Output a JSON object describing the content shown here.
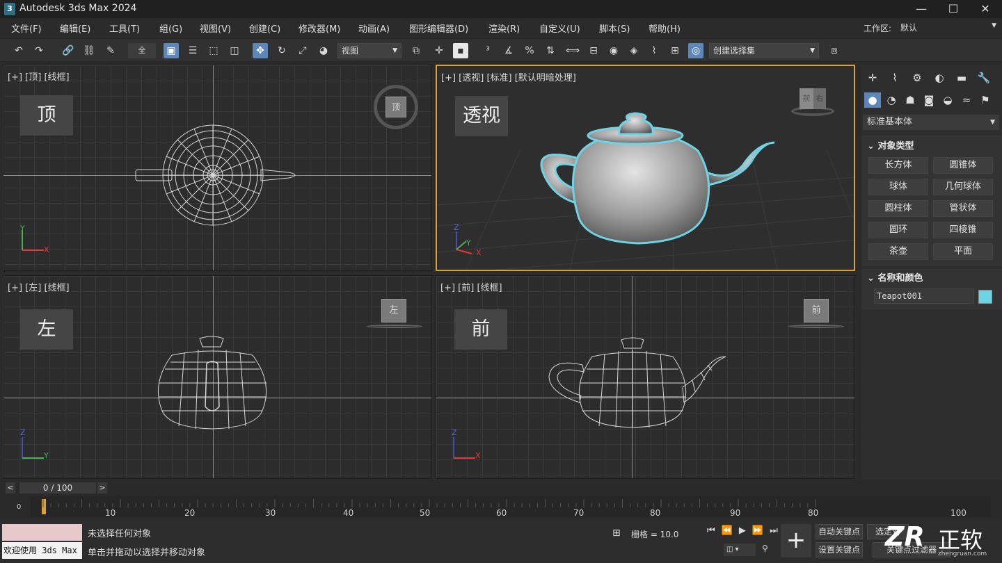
{
  "app": {
    "title": "Autodesk 3ds Max 2024",
    "icon_label": "3"
  },
  "window_controls": {
    "minimize": "—",
    "maximize": "☐",
    "close": "✕"
  },
  "menu": [
    "文件(F)",
    "编辑(E)",
    "工具(T)",
    "组(G)",
    "视图(V)",
    "创建(C)",
    "修改器(M)",
    "动画(A)",
    "图形编辑器(D)",
    "渲染(R)",
    "自定义(U)",
    "脚本(S)",
    "帮助(H)"
  ],
  "workspace": {
    "label": "工作区:",
    "value": "默认"
  },
  "toolbar": {
    "view_combo": "视图",
    "selection_set": "创建选择集"
  },
  "viewports": {
    "top": {
      "label": "[+] [顶] [线框]",
      "tag": "顶",
      "cube_label": "顶",
      "axis_x": "X",
      "axis_y": "Y"
    },
    "persp": {
      "label": "[+] [透视] [标准] [默认明暗处理]",
      "tag": "透视",
      "cube_face1": "前",
      "cube_face2": "右",
      "axis_x": "X",
      "axis_y": "Y",
      "axis_z": "Z"
    },
    "left": {
      "label": "[+] [左] [线框]",
      "tag": "左",
      "cube_label": "左",
      "axis_y": "Y",
      "axis_z": "Z"
    },
    "front": {
      "label": "[+] [前] [线框]",
      "tag": "前",
      "cube_label": "前",
      "axis_x": "X",
      "axis_z": "Z"
    }
  },
  "command_panel": {
    "dropdown": "标准基本体",
    "object_type_title": "对象类型",
    "buttons": [
      "长方体",
      "圆锥体",
      "球体",
      "几何球体",
      "圆柱体",
      "管状体",
      "圆环",
      "四棱锥",
      "茶壶",
      "平面"
    ],
    "name_color_title": "名称和颜色",
    "object_name": "Teapot001",
    "object_color": "#6fd3e3"
  },
  "timeline": {
    "frame_display": "0 / 100",
    "prev": "<",
    "next": ">",
    "ticks": [
      "0",
      "10",
      "20",
      "30",
      "40",
      "50",
      "60",
      "70",
      "80",
      "90",
      "100"
    ]
  },
  "status": {
    "maxscript": "欢迎使用 3ds Max",
    "selection": "未选择任何对象",
    "prompt": "单击并拖动以选择并移动对象",
    "grid": "栅格 = 10.0",
    "auto_key": "自动关键点",
    "set_key": "设置关键点",
    "selected": "选定对",
    "key_filter": "关键点过滤器"
  },
  "watermark": {
    "logo": "ZR",
    "text": "正软",
    "url": "zhengruan.com"
  },
  "colors": {
    "accent": "#5c87b8",
    "active_viewport": "#d8a13a",
    "selection_outline": "#6fd3e3"
  }
}
